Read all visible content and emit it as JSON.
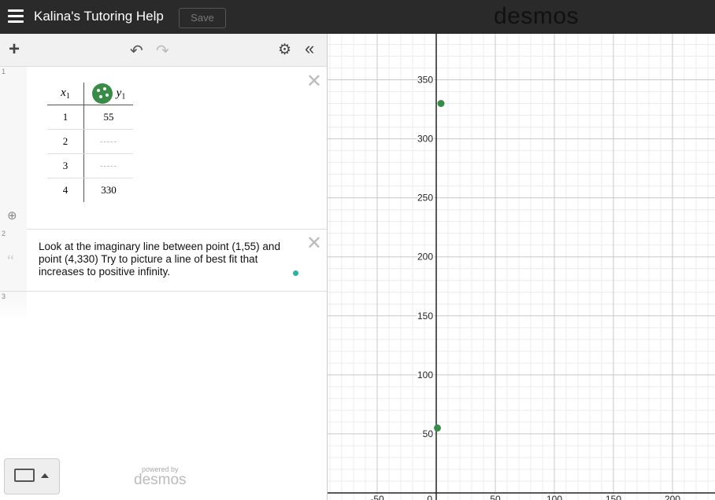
{
  "app": {
    "title": "Kalina's Tutoring Help",
    "save_label": "Save",
    "brand": "desmos"
  },
  "toolbar": {
    "add_icon": "plus-icon",
    "undo_icon": "undo-icon",
    "redo_icon": "redo-icon",
    "settings_icon": "gear-icon",
    "collapse_icon": "double-chevron-left-icon"
  },
  "expressions": [
    {
      "number": "1",
      "type": "table",
      "headers": {
        "x": "x",
        "x_sub": "1",
        "y": "y",
        "y_sub": "1"
      },
      "rows": [
        {
          "x": "1",
          "y": "55"
        },
        {
          "x": "2",
          "y": "-----"
        },
        {
          "x": "3",
          "y": "-----"
        },
        {
          "x": "4",
          "y": "330"
        }
      ],
      "point_color": "#388c46"
    },
    {
      "number": "2",
      "type": "note",
      "text": "Look at the imaginary line between point (1,55) and point (4,330)  Try to picture a line of best fit that increases to positive infinity.",
      "dot_color": "#2bb3a3"
    },
    {
      "number": "3",
      "type": "empty"
    }
  ],
  "footer": {
    "keyboard_icon": "keyboard-icon",
    "powered_by": "powered by",
    "brand": "desmos"
  },
  "chart_data": {
    "type": "scatter",
    "x_ticks": [
      -50,
      50,
      100,
      150,
      200
    ],
    "y_ticks": [
      50,
      100,
      150,
      200,
      250,
      300,
      350
    ],
    "origin_label": "0",
    "xlim": [
      -92,
      236
    ],
    "ylim": [
      -6,
      389
    ],
    "grid": true,
    "series": [
      {
        "color": "#388c46",
        "points": [
          [
            1,
            55
          ],
          [
            4,
            330
          ]
        ]
      }
    ]
  }
}
